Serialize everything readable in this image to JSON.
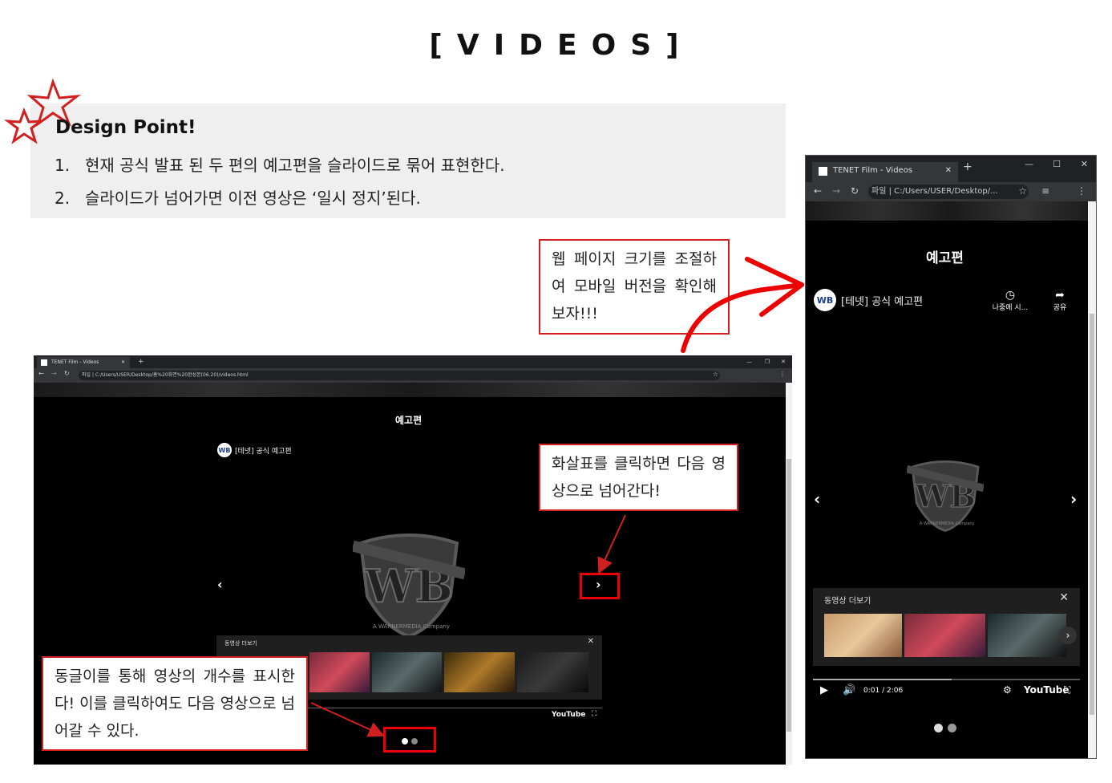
{
  "page_title": "[VIDEOS]",
  "design_point": {
    "heading": "Design Point!",
    "items": [
      {
        "num": "1.",
        "text": "현재 공식 발표 된 두 편의 예고편을 슬라이드로 묶어 표현한다."
      },
      {
        "num": "2.",
        "text": "슬라이드가 넘어가면 이전 영상은 ‘일시 정지’된다."
      }
    ]
  },
  "callouts": {
    "resize": "웹 페이지 크기를 조절하여 모바일 버전을 확인해보자!!!",
    "arrow": "화살표를 클릭하면 다음 영상으로 넘어간다!",
    "dots": "동글이를 통해 영상의 개수를 표시한다! 이를 클릭하여도 다음 영상으로 넘어갈 수 있다."
  },
  "desktop": {
    "tab_title": "TENET Film - Videos",
    "address": "파일  |  C:/Users/USER/Desktop/홈%20화면%20완성본(06.20)/videos.html",
    "section_title": "예고편",
    "video_title": "[테넷] 공식 예고편",
    "more_videos": "동영상 더보기",
    "wb_company": "A WARNERMEDIA Company",
    "youtube": "YouTube"
  },
  "mobile": {
    "tab_title": "TENET Film - Videos",
    "address": "파일  |  C:/Users/USER/Desktop/...",
    "section_title": "예고편",
    "video_title": "[테넷] 공식 예고편",
    "watch_later": "나중에 시...",
    "share": "공유",
    "more_videos": "동영상 더보기",
    "time": "0:01 / 2:06",
    "youtube": "YouTube",
    "wb_company": "A WARNERMEDIA Company"
  },
  "colors": {
    "accent_red": "#d21f1f",
    "bg_dark": "#000000",
    "panel": "#efefef"
  }
}
